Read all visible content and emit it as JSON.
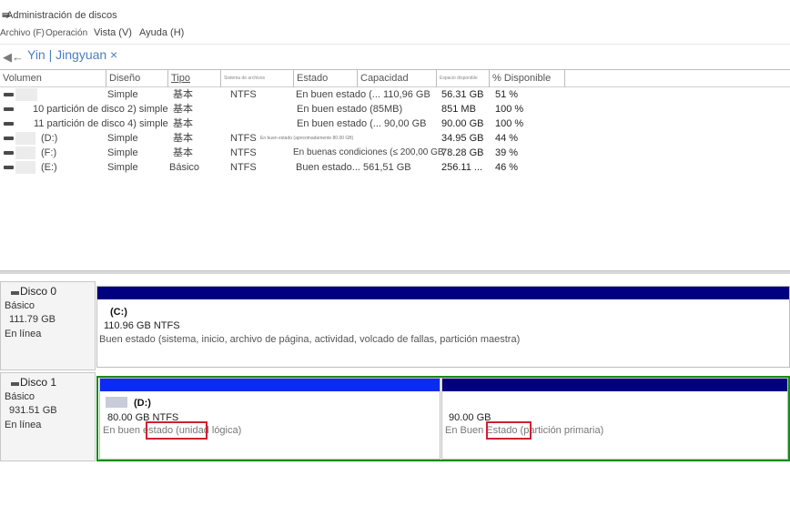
{
  "window": {
    "title": "Administración de discos"
  },
  "menu": {
    "items": [
      "Archivo (F)",
      "Operación",
      "Vista (V)",
      "Ayuda (H)"
    ]
  },
  "tab": {
    "label": "Yin | Jingyuan ×"
  },
  "list": {
    "columns": [
      "Volumen",
      "Diseño",
      "Tipo",
      "Sistema de archivos",
      "Estado",
      "Capacidad",
      "Espacio disponible",
      "% Disponible"
    ],
    "rows": [
      {
        "volume": "",
        "layout": "Simple",
        "type": "基本",
        "fs": "NTFS",
        "status": "En buen estado (... 110,96 GB",
        "free": "56.31 GB",
        "pct": "51 %"
      },
      {
        "volume": "",
        "layout": "10 partición de disco 2) simple",
        "type": "基本",
        "fs": "",
        "status": "En buen estado (85MB)",
        "free": "851 MB",
        "pct": "100 %"
      },
      {
        "volume": "",
        "layout": "11 partición de disco 4) simple",
        "type": "基本",
        "fs": "",
        "status": "En buen estado (... 90,00 GB",
        "free": "90.00 GB",
        "pct": "100 %"
      },
      {
        "volume": "(D:)",
        "layout": "Simple",
        "type": "基本",
        "fs": "NTFS",
        "status": "En buen estado (aproximadamente 80.00 GB)",
        "free": "34.95 GB",
        "pct": "44 %"
      },
      {
        "volume": "(F:)",
        "layout": "Simple",
        "type": "基本",
        "fs": "NTFS",
        "status": "En buenas condiciones (≤ 200,00 GB",
        "free": "78.28 GB",
        "pct": "39 %"
      },
      {
        "volume": "(E:)",
        "layout": "Simple",
        "type": "Básico",
        "fs": "NTFS",
        "status": "Buen estado... 561,51 GB",
        "free": "256.11 ...",
        "pct": "46 %"
      }
    ]
  },
  "disks": [
    {
      "name": "Disco 0",
      "kind": "Básico",
      "size": "111.79 GB",
      "state": "En línea",
      "volumes": [
        {
          "label": "(C:)",
          "size": "110.96 GB NTFS",
          "status": "Buen estado (sistema, inicio, archivo de página, actividad, volcado de fallas, partición maestra)"
        }
      ]
    },
    {
      "name": "Disco 1",
      "kind": "Básico",
      "size": "931.51 GB",
      "state": "En línea",
      "volumes": [
        {
          "label": "(D:)",
          "size": "80.00 GB NTFS",
          "status": "En buen estado (unidad lógica)"
        },
        {
          "label": "",
          "size": "90.00 GB",
          "status": "En Buen Estado (partición primaria)"
        }
      ]
    }
  ],
  "colors": {
    "primary_bar": "#000080",
    "logical_bar": "#0a2cf0",
    "selection_border": "#1a8a1a",
    "highlight_red": "#d02030",
    "link_blue": "#4a7fc0"
  }
}
